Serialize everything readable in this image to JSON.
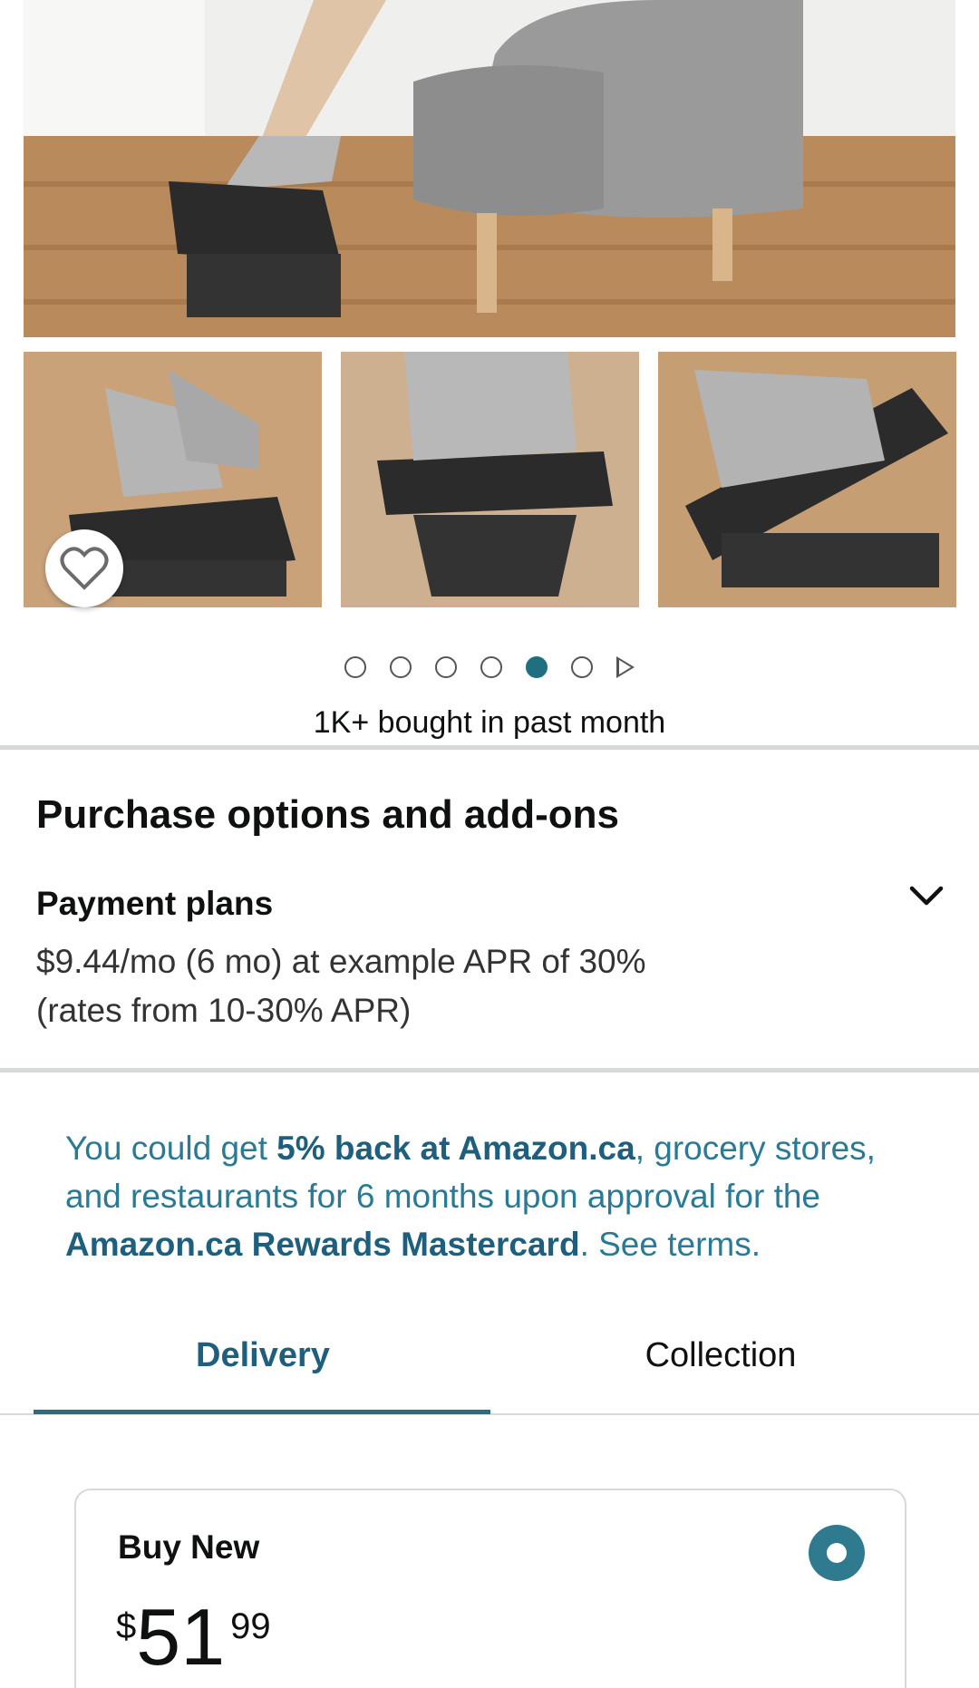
{
  "product": {
    "bought_text": "1K+ bought in past month",
    "carousel": {
      "total_dots": 6,
      "active_index": 4
    }
  },
  "purchase_options": {
    "title": "Purchase options and add-ons",
    "payment_plans": {
      "title": "Payment plans",
      "line1": "$9.44/mo (6 mo) at example APR of 30%",
      "line2": "(rates from 10-30% APR)"
    }
  },
  "promo": {
    "part1": "You could get ",
    "bold1": "5% back at Amazon.ca",
    "part2": ", grocery stores, and restaurants for 6 months upon approval for the ",
    "bold2": "Amazon.ca Rewards Mastercard",
    "part3": ". See terms."
  },
  "tabs": {
    "delivery": "Delivery",
    "collection": "Collection"
  },
  "buy_new": {
    "title": "Buy New",
    "currency": "$",
    "price_whole": "51",
    "price_fraction": "99"
  },
  "colors": {
    "accent": "#1f6f80",
    "link": "#2a7a95",
    "divider": "#d5d9d9"
  }
}
